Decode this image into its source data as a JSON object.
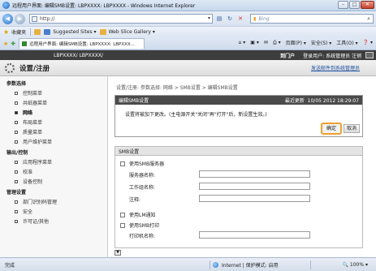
{
  "window": {
    "title": "远程用户界面: 编辑SMB设置: LBPXXXX: LBPXXXX - Windows Internet Explorer",
    "min": "–",
    "max": "□",
    "close": "✕"
  },
  "address": {
    "url": "http://",
    "search_placeholder": "Bing"
  },
  "favorites": {
    "label": "收藏夹",
    "items": [
      "Suggested Sites ▾",
      "Web Slice Gallery ▾"
    ]
  },
  "tab": {
    "title": "远程用户界面: 编辑SMB设置: LBPXXXX: LBPXXX..."
  },
  "commands": {
    "page": "页面(P) ▾",
    "safety": "安全(S) ▾",
    "tools": "工具(O) ▾",
    "help": "❓ ▾"
  },
  "header": {
    "model": "LBPXXXX/ LBPXXXX/",
    "portal": "到门户",
    "user": "登录用户: 系统管理员 注销",
    "title": "设置/注册",
    "mail": "发送邮件到系统管理员"
  },
  "sidebar": {
    "sections": [
      {
        "title": "参数选择",
        "items": [
          "控制菜单",
          "共纸器菜单",
          "网络",
          "布局菜单",
          "质量菜单",
          "用户维护菜单"
        ]
      },
      {
        "title": "输出/控制",
        "items": [
          "应用程序菜单",
          "校准",
          "设备控制"
        ]
      },
      {
        "title": "管理设置",
        "items": [
          "部门识别码管理",
          "安全",
          "许可证/其他"
        ]
      }
    ]
  },
  "main": {
    "breadcrumb": "设置/注册: 参数选择: 网络 > SMB设置 > 编辑SMB设置",
    "edit_box": {
      "title": "编辑SMB设置",
      "updated_label": "最近更新",
      "updated_value": "10/05 2012 18:29:07",
      "note": "设置将被加下更改。(主电源开关\"关闭\"再\"打开\"后，新设置生效。)",
      "ok": "确定",
      "cancel": "取消"
    },
    "smb_box": {
      "title": "SMB设置",
      "use_server": "使用SMB服务器",
      "server_name": "服务器名称:",
      "workgroup": "工作组名称:",
      "comment": "注释:",
      "use_lm": "使用LM通知",
      "use_print": "使用SMB打印",
      "printer_name": "打印机名称:"
    }
  },
  "status": {
    "done": "完成",
    "zone": "Internet | 保护模式: 启用",
    "zoom": "🔍 100% ▾"
  }
}
